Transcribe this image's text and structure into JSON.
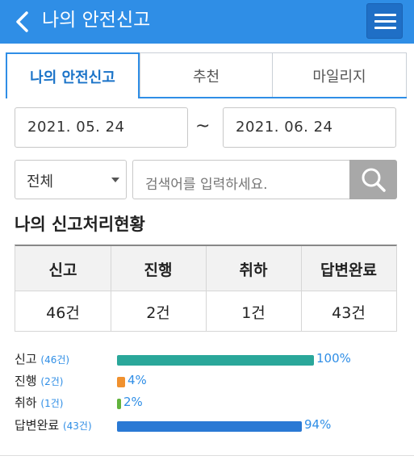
{
  "header": {
    "title": "나의 안전신고",
    "color": "#2f8ee6"
  },
  "tabs": [
    {
      "label": "나의 안전신고",
      "active": true
    },
    {
      "label": "추천",
      "active": false
    },
    {
      "label": "마일리지",
      "active": false
    }
  ],
  "filter": {
    "date_from": "2021. 05. 24",
    "date_separator": "~",
    "date_to": "2021. 06. 24",
    "category_selected": "전체",
    "search_placeholder": "검색어를 입력하세요."
  },
  "status": {
    "title": "나의 신고처리현황",
    "headers": [
      "신고",
      "진행",
      "취하",
      "답변완료"
    ],
    "values": [
      "46건",
      "2건",
      "1건",
      "43건"
    ]
  },
  "bars": [
    {
      "label": "신고",
      "count": "(46건)",
      "percent": 100,
      "percent_text": "100%",
      "color": "#2aa79a"
    },
    {
      "label": "진행",
      "count": "(2건)",
      "percent": 4,
      "percent_text": "4%",
      "color": "#f0912f"
    },
    {
      "label": "취하",
      "count": "(1건)",
      "percent": 2,
      "percent_text": "2%",
      "color": "#62b33d"
    },
    {
      "label": "답변완료",
      "count": "(43건)",
      "percent": 94,
      "percent_text": "94%",
      "color": "#2a79d4"
    }
  ]
}
